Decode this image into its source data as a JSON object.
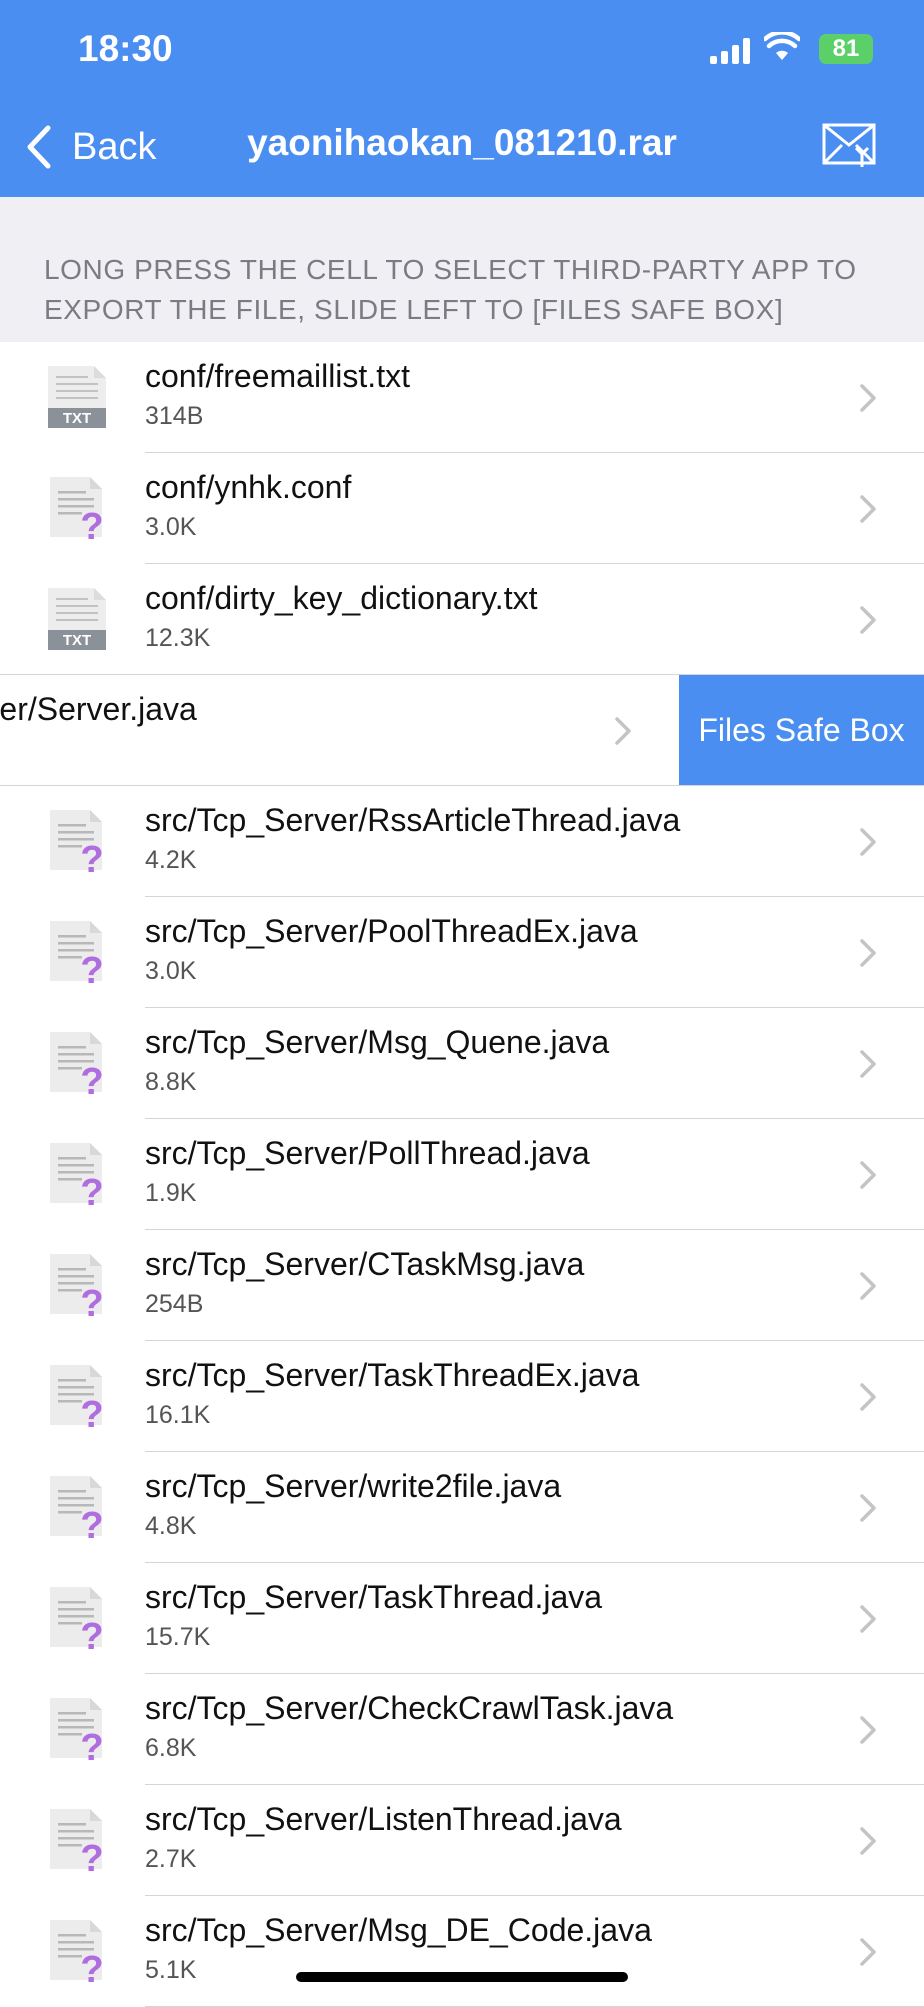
{
  "status_bar": {
    "time": "18:30",
    "battery": "81"
  },
  "nav": {
    "back_label": "Back",
    "title": "yaonihaokan_081210.rar"
  },
  "hint": "LONG PRESS THE CELL TO SELECT THIRD-PARTY APP TO EXPORT THE FILE, SLIDE LEFT TO [FILES SAFE BOX]",
  "files": [
    {
      "name": "conf/freemaillist.txt",
      "size": "314B",
      "icon": "txt-file-icon"
    },
    {
      "name": "conf/ynhk.conf",
      "size": "3.0K",
      "icon": "unknown-file-icon"
    },
    {
      "name": "conf/dirty_key_dictionary.txt",
      "size": "12.3K",
      "icon": "txt-file-icon"
    },
    {
      "name": "p_Server/Server.java",
      "size": "",
      "icon": "",
      "swiped": true,
      "action_label": "Files Safe Box"
    },
    {
      "name": "src/Tcp_Server/RssArticleThread.java",
      "size": "4.2K",
      "icon": "unknown-file-icon"
    },
    {
      "name": "src/Tcp_Server/PoolThreadEx.java",
      "size": "3.0K",
      "icon": "unknown-file-icon"
    },
    {
      "name": "src/Tcp_Server/Msg_Quene.java",
      "size": "8.8K",
      "icon": "unknown-file-icon"
    },
    {
      "name": "src/Tcp_Server/PollThread.java",
      "size": "1.9K",
      "icon": "unknown-file-icon"
    },
    {
      "name": "src/Tcp_Server/CTaskMsg.java",
      "size": "254B",
      "icon": "unknown-file-icon"
    },
    {
      "name": "src/Tcp_Server/TaskThreadEx.java",
      "size": "16.1K",
      "icon": "unknown-file-icon"
    },
    {
      "name": "src/Tcp_Server/write2file.java",
      "size": "4.8K",
      "icon": "unknown-file-icon"
    },
    {
      "name": "src/Tcp_Server/TaskThread.java",
      "size": "15.7K",
      "icon": "unknown-file-icon"
    },
    {
      "name": "src/Tcp_Server/CheckCrawlTask.java",
      "size": "6.8K",
      "icon": "unknown-file-icon"
    },
    {
      "name": "src/Tcp_Server/ListenThread.java",
      "size": "2.7K",
      "icon": "unknown-file-icon"
    },
    {
      "name": "src/Tcp_Server/Msg_DE_Code.java",
      "size": "5.1K",
      "icon": "unknown-file-icon"
    }
  ],
  "colors": {
    "accent": "#4a8ef2",
    "separator": "#d5d5d9",
    "hint_bg": "#efeff4",
    "question_mark": "#b06de0"
  }
}
